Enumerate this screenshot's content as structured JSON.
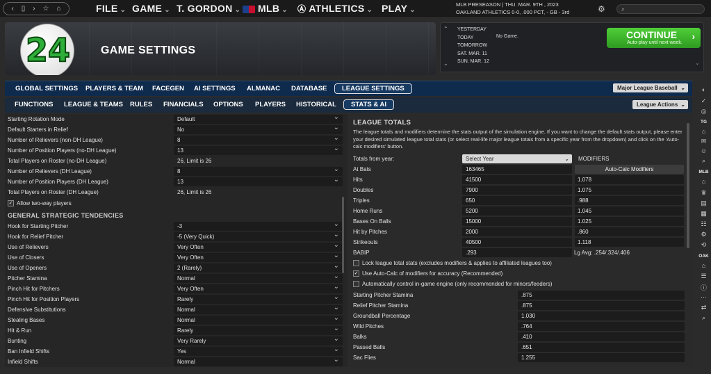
{
  "topbar": {
    "menus": [
      "FILE",
      "GAME",
      "T. GORDON",
      "MLB",
      "ATHLETICS",
      "PLAY"
    ],
    "preseason_line1": "MLB PRESEASON  |  THU. MAR. 9TH , 2023",
    "preseason_line2": "OAKLAND ATHLETICS  0-0, .000 PCT, - GB - 3rd"
  },
  "header": {
    "title": "GAME SETTINGS",
    "logo_number": "24"
  },
  "schedule": {
    "days": [
      "YESTERDAY",
      "TODAY",
      "TOMORROW",
      "SAT. MAR. 11",
      "SUN. MAR. 12"
    ],
    "today_game": "No Game.",
    "continue_label": "CONTINUE",
    "continue_sub": "Auto-play until next week."
  },
  "tabs1": {
    "items": [
      "GLOBAL SETTINGS",
      "PLAYERS & TEAM",
      "FACEGEN",
      "AI SETTINGS",
      "ALMANAC",
      "DATABASE",
      "LEAGUE SETTINGS"
    ],
    "selected": "LEAGUE SETTINGS",
    "league_dropdown": "Major League Baseball"
  },
  "tabs2": {
    "items": [
      "FUNCTIONS",
      "LEAGUE & TEAMS",
      "RULES",
      "FINANCIALS",
      "OPTIONS",
      "PLAYERS",
      "HISTORICAL",
      "STATS & AI"
    ],
    "selected": "STATS & AI",
    "actions_dropdown": "League Actions"
  },
  "left": {
    "rows": [
      {
        "label": "Starting Rotation Mode",
        "value": "Default"
      },
      {
        "label": "Default Starters in Relief",
        "value": "No"
      },
      {
        "label": "Number of Relievers (non-DH League)",
        "value": "8"
      },
      {
        "label": "Number of Position Players (no-DH League)",
        "value": "13"
      },
      {
        "label": "Total Players on Roster (no-DH League)",
        "value": "26, Limit is 26"
      },
      {
        "label": "Number of Relievers (DH League)",
        "value": "8"
      },
      {
        "label": "Number of Position Players (DH League)",
        "value": "13"
      },
      {
        "label": "Total Players on Roster (DH League)",
        "value": "26, Limit is 26"
      }
    ],
    "two_way_label": "Allow two-way players",
    "section_title": "GENERAL STRATEGIC TENDENCIES",
    "strategy_rows": [
      {
        "label": "Hook for Starting Pitcher",
        "value": "-3"
      },
      {
        "label": "Hook for Relief Pitcher",
        "value": "-5 (Very Quick)"
      },
      {
        "label": "Use of Relievers",
        "value": "Very Often"
      },
      {
        "label": "Use of Closers",
        "value": "Very Often"
      },
      {
        "label": "Use of Openers",
        "value": "2 (Rarely)"
      },
      {
        "label": "Pitcher Stamina",
        "value": "Normal"
      },
      {
        "label": "Pinch Hit for Pitchers",
        "value": "Very Often"
      },
      {
        "label": "Pinch Hit for Position Players",
        "value": "Rarely"
      },
      {
        "label": "Defensive Substitutions",
        "value": "Normal"
      },
      {
        "label": "Stealing Bases",
        "value": "Normal"
      },
      {
        "label": "Hit & Run",
        "value": "Rarely"
      },
      {
        "label": "Bunting",
        "value": "Very Rarely"
      },
      {
        "label": "Ban Infield Shifts",
        "value": "Yes"
      },
      {
        "label": "Infield Shifts",
        "value": "Normal"
      }
    ]
  },
  "right": {
    "title": "LEAGUE TOTALS",
    "description": "The league totals and modifiers determine the stats output of the simulation engine. If you want to change the default stats output, please enter your desired simulated league total stats (or select real-life major league totals from a specific year from the dropdown) and click on the 'Auto-calc modifiers' button.",
    "totals_from_year_label": "Totals from year:",
    "select_year": "Select Year",
    "modifiers_header": "MODIFIERS",
    "autocalc_label": "Auto-Calc Modifiers",
    "stats": [
      {
        "label": "At Bats",
        "total": "163465",
        "mod": ""
      },
      {
        "label": "Hits",
        "total": "41500",
        "mod": "1.078"
      },
      {
        "label": "Doubles",
        "total": "7900",
        "mod": "1.075"
      },
      {
        "label": "Triples",
        "total": "650",
        "mod": ".988"
      },
      {
        "label": "Home Runs",
        "total": "5200",
        "mod": "1.045"
      },
      {
        "label": "Bases On Balls",
        "total": "15000",
        "mod": "1.025"
      },
      {
        "label": "Hit by Pitches",
        "total": "2000",
        "mod": ".860"
      },
      {
        "label": "Strikeouts",
        "total": "40500",
        "mod": "1.118"
      }
    ],
    "babip_label": "BABIP",
    "babip_value": ".293",
    "lg_avg": "Lg Avg: .254/.324/.406",
    "checkboxes": [
      {
        "label": "Lock league total stats (excludes modifiers & applies to affiliated leagues too)",
        "checked": false
      },
      {
        "label": "Use Auto-Calc of modifiers for accuracy (Recommended)",
        "checked": true
      },
      {
        "label": "Automatically control in-game engine (only recommended for minors/feeders)",
        "checked": false
      }
    ],
    "engine_rows": [
      {
        "label": "Starting Pitcher Stamina",
        "value": ".875"
      },
      {
        "label": "Relief Pitcher Stamina",
        "value": ".875"
      },
      {
        "label": "Groundball Percentage",
        "value": "1.030"
      },
      {
        "label": "Wild Pitches",
        "value": ".764"
      },
      {
        "label": "Balks",
        "value": ".410"
      },
      {
        "label": "Passed Balls",
        "value": ".651"
      },
      {
        "label": "Sac Flies",
        "value": "1.255"
      }
    ]
  },
  "sidebar": {
    "labels": [
      "TG",
      "MLB",
      "OAK"
    ]
  }
}
